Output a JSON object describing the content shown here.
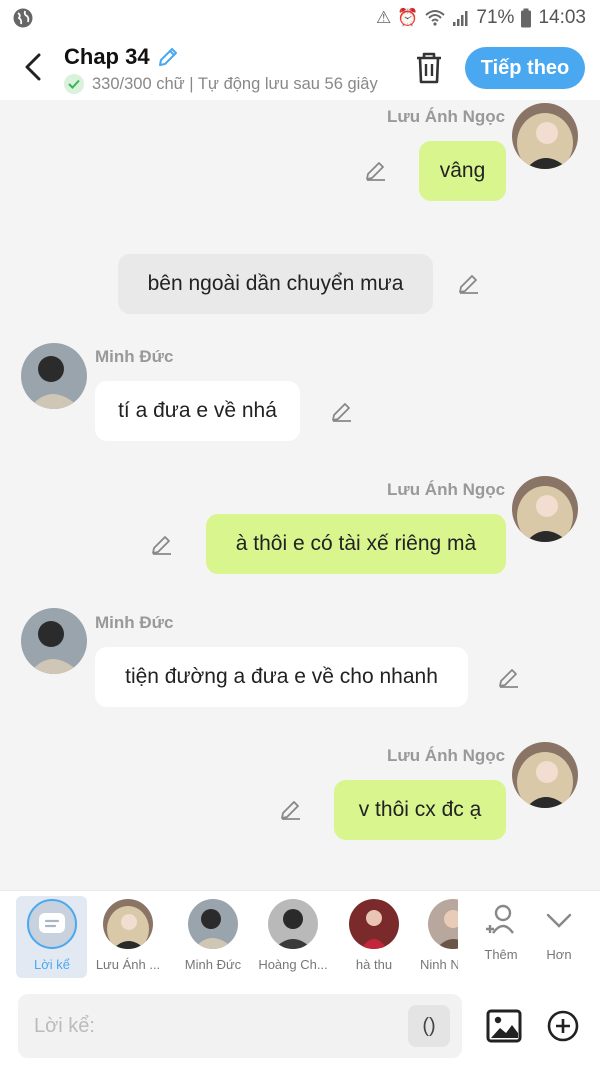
{
  "status_bar": {
    "battery": "71%",
    "time": "14:03"
  },
  "header": {
    "title": "Chap 34",
    "subtitle": "330/300 chữ | Tự động lưu sau 56 giây",
    "next_button": "Tiếp theo"
  },
  "messages": [
    {
      "type": "right",
      "speaker": "Lưu Ánh Ngọc",
      "text": "vâng"
    },
    {
      "type": "narration",
      "text": "bên ngoài dần chuyển mưa"
    },
    {
      "type": "left",
      "speaker": "Minh Đức",
      "text": "tí a đưa e về nhá"
    },
    {
      "type": "right",
      "speaker": "Lưu Ánh Ngọc",
      "text": "à thôi e có tài xế riêng mà"
    },
    {
      "type": "left",
      "speaker": "Minh Đức",
      "text": "tiện đường a đưa e về cho nhanh"
    },
    {
      "type": "right",
      "speaker": "Lưu Ánh Ngọc",
      "text": "v thôi cx đc ạ"
    }
  ],
  "characters": [
    {
      "label": "Lời kể"
    },
    {
      "label": "Lưu Ánh ..."
    },
    {
      "label": "Minh Đức"
    },
    {
      "label": "Hoàng Ch..."
    },
    {
      "label": "hà thu"
    },
    {
      "label": "Ninh N"
    }
  ],
  "actions": {
    "add": "Thêm",
    "more": "Hơn"
  },
  "composer": {
    "placeholder": "Lời kể:",
    "paren": "()"
  }
}
